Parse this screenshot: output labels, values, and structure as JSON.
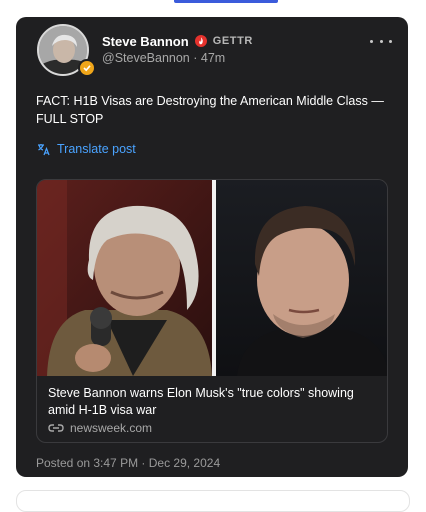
{
  "post": {
    "author_name": "Steve Bannon",
    "platform": "GETTR",
    "handle": "@SteveBannon",
    "time_sep": "·",
    "time_ago": "47m",
    "text": "FACT: H1B Visas are Destroying the American Middle Class — FULL STOP",
    "translate_label": "Translate post",
    "posted_at": "Posted on 3:47 PM · Dec 29, 2024"
  },
  "link_preview": {
    "headline": "Steve Bannon warns Elon Musk's \"true colors\" showing amid H-1B visa war",
    "domain": "newsweek.com"
  },
  "icons": {
    "verified": "verified-badge-icon",
    "flame": "flame-icon",
    "more": "more-options-icon",
    "translate": "translate-icon",
    "link": "link-icon"
  },
  "colors": {
    "card_bg": "#1f1f21",
    "accent_link": "#4aa3ff",
    "flame": "#e5322d",
    "verified": "#f0a61a"
  }
}
